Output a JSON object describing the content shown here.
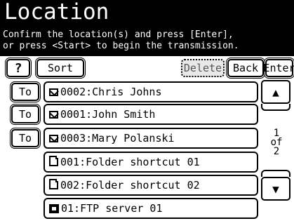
{
  "header": {
    "title": "Location",
    "instruction_line1": "Confirm the location(s) and press [Enter],",
    "instruction_line2": "or press <Start> to begin the transmission."
  },
  "toolbar": {
    "help_label": "?",
    "sort_label": "Sort",
    "delete_label": "Delete",
    "back_label": "Back",
    "enter_label": "Enter"
  },
  "entries": [
    {
      "to_label": "To",
      "icon": "mail-icon",
      "text": "0002:Chris Johns"
    },
    {
      "to_label": "To",
      "icon": "mail-icon",
      "text": "0001:John Smith"
    },
    {
      "to_label": "To",
      "icon": "mail-icon",
      "text": "0003:Mary Polanski"
    },
    {
      "to_label": "",
      "icon": "folder-icon",
      "text": "001:Folder shortcut 01"
    },
    {
      "to_label": "",
      "icon": "folder-icon",
      "text": "002:Folder shortcut 02"
    },
    {
      "to_label": "",
      "icon": "ftp-server-icon",
      "text": "01:FTP server 01"
    }
  ],
  "pager": {
    "current": "1",
    "of_label": "of",
    "total": "2",
    "up_arrow": "▲",
    "down_arrow": "▼"
  }
}
